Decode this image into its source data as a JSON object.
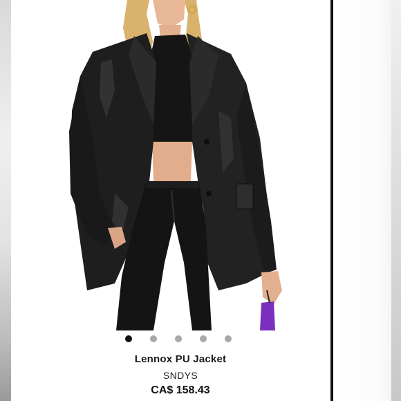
{
  "product": {
    "name": "Lennox PU Jacket",
    "brand": "SNDYS",
    "price": "CA$ 158.43",
    "image_alt_icon": "product-photo"
  },
  "carousel": {
    "total": 5,
    "active_index": 0
  },
  "colors": {
    "dot_active": "#111111",
    "dot_inactive": "#a8a8a8",
    "accent_bag": "#7b2fbe"
  }
}
